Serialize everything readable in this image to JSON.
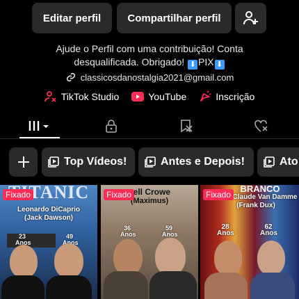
{
  "header": {
    "edit_label": "Editar perfil",
    "share_label": "Compartilhar perfil"
  },
  "bio": {
    "line1": "Ajude o Perfil com uma contribuição! Conta",
    "line2_a": "desqualificada. Obrigado!",
    "line2_pix": "PIX",
    "email": "classicosdanostalgia2021@gmail.com"
  },
  "links": [
    {
      "label": "TikTok Studio",
      "icon": "tiktok-studio-icon"
    },
    {
      "label": "YouTube",
      "icon": "youtube-icon"
    },
    {
      "label": "Inscrição",
      "icon": "subscription-icon"
    }
  ],
  "tabs": [
    "videos-grid",
    "private",
    "reposts",
    "liked"
  ],
  "playlists": [
    {
      "label": "Top Vídeos!"
    },
    {
      "label": "Antes e Depois!"
    },
    {
      "label": "Ato"
    }
  ],
  "videos": [
    {
      "pinned": "Fixado",
      "title": "TITANIC",
      "line1": "Leonardo DiCaprio",
      "line2": "(Jack Dawson)",
      "age_left": "23 Anos",
      "age_right": "49 Anos"
    },
    {
      "pinned": "Fixado",
      "title": "sell Crowe",
      "line1": "(Maximus)",
      "line2": "",
      "age_left": "36 Anos",
      "age_right": "59 Anos"
    },
    {
      "pinned": "Fixado",
      "title": "BRANCO",
      "line1": "Jean-Claude Van Damme",
      "line2": "(Frank Dux)",
      "age_left": "28 Anos",
      "age_right": "62 Anos"
    }
  ],
  "colors": {
    "accent": "#fe2c55",
    "button_bg": "#2a2a2c",
    "pix_box": "#3b9bff"
  }
}
